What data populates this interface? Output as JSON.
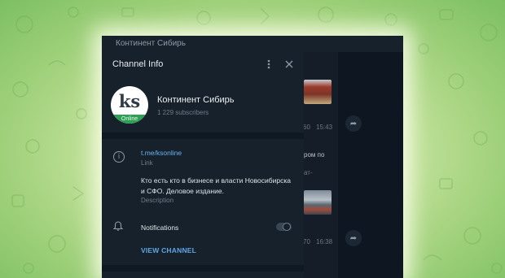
{
  "chat": {
    "header_title": "Континент Сибирь",
    "messages": [
      {
        "views": "60",
        "time": "15:43"
      },
      {
        "views": "70",
        "time": "16:38"
      }
    ],
    "fragment_1": "ром по",
    "fragment_2": "ат-"
  },
  "panel": {
    "title": "Channel Info",
    "avatar_initials": "ks",
    "avatar_status": "Online",
    "channel_name": "Континент Сибирь",
    "subscribers": "1 229 subscribers",
    "link": "t.me/ksonline",
    "link_label": "Link",
    "description": "Кто есть кто в бизнесе и власти Новосибирска и СФО. Деловое издание.",
    "description_label": "Description",
    "notifications_label": "Notifications",
    "notifications_enabled": false,
    "view_channel_label": "VIEW CHANNEL"
  },
  "icons": [
    "more-vertical-icon",
    "close-icon",
    "info-icon",
    "bell-icon",
    "share-icon"
  ]
}
